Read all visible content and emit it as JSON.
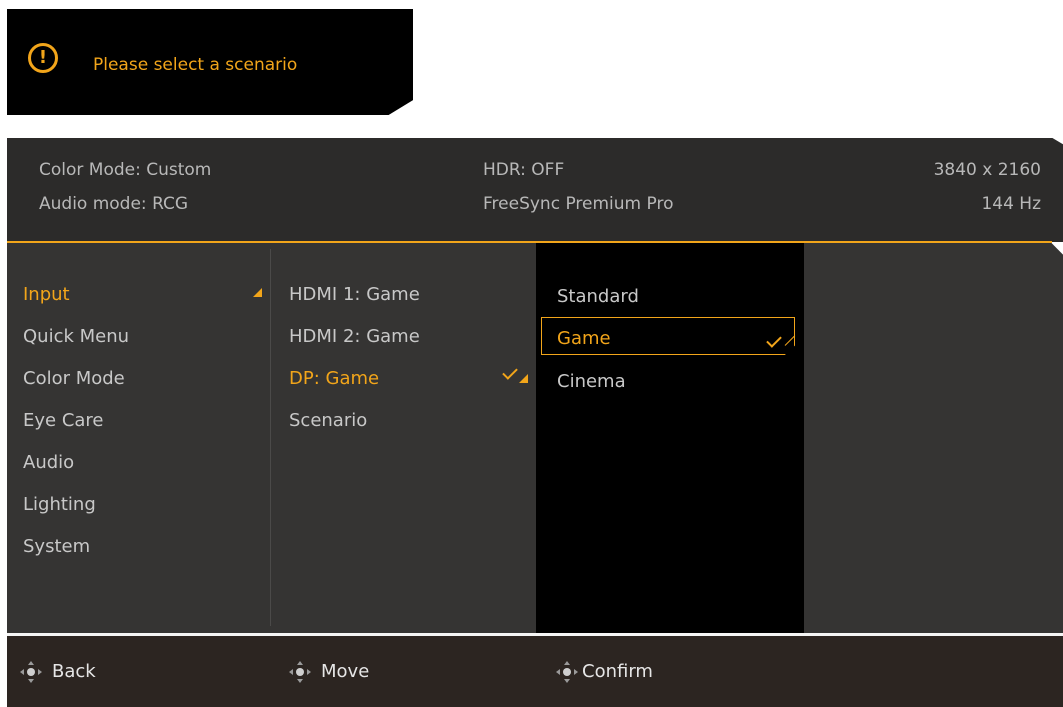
{
  "toast": {
    "icon": "exclamation-circle-icon",
    "message": "Please select a scenario"
  },
  "status": {
    "color_mode": "Color Mode: Custom",
    "audio_mode": "Audio mode: RCG",
    "hdr": "HDR: OFF",
    "freesync": "FreeSync Premium Pro",
    "resolution": "3840 x 2160",
    "refresh": "144 Hz"
  },
  "main_menu": {
    "items": [
      {
        "label": "Input",
        "active": true
      },
      {
        "label": "Quick Menu",
        "active": false
      },
      {
        "label": "Color Mode",
        "active": false
      },
      {
        "label": "Eye Care",
        "active": false
      },
      {
        "label": "Audio",
        "active": false
      },
      {
        "label": "Lighting",
        "active": false
      },
      {
        "label": "System",
        "active": false
      }
    ]
  },
  "sub_menu": {
    "items": [
      {
        "label": "HDMI 1: Game",
        "active": false
      },
      {
        "label": "HDMI 2: Game",
        "active": false
      },
      {
        "label": "DP: Game",
        "active": true
      },
      {
        "label": "Scenario",
        "active": false
      }
    ]
  },
  "options": {
    "items": [
      {
        "label": "Standard",
        "selected": false
      },
      {
        "label": "Game",
        "selected": true
      },
      {
        "label": "Cinema",
        "selected": false
      }
    ]
  },
  "footer": {
    "back": "Back",
    "move": "Move",
    "confirm": "Confirm",
    "nav_icon": "five-way-joystick-icon"
  },
  "colors": {
    "accent": "#f2a51a",
    "panel": "#353433",
    "header": "#2c2b2a",
    "footer": "#2c2521"
  }
}
